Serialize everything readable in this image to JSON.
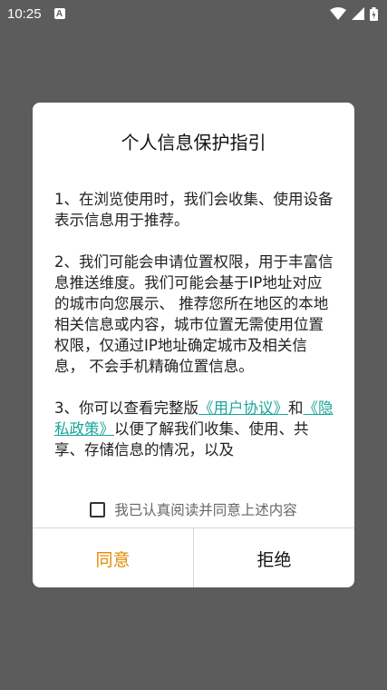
{
  "status_bar": {
    "time": "10:25",
    "notification_icon": "A",
    "icons": [
      "wifi-icon",
      "signal-icon",
      "battery-icon"
    ]
  },
  "dialog": {
    "title": "个人信息保护指引",
    "paragraph1": "1、在浏览使用时，我们会收集、使用设备表示信息用于推荐。",
    "paragraph2": " 2、我们可能会申请位置权限，用于丰富信息推送维度。我们可能会基于IP地址对应的城市向您展示、 推荐您所在地区的本地相关信息或内容，城市位置无需使用位置权限，仅通过IP地址确定城市及相关信息， 不会手机精确位置信息。",
    "paragraph3_prefix": " 3、你可以查看完整版",
    "user_agreement_link": "《用户协议》",
    "paragraph3_and": "和",
    "privacy_policy_link": "《隐私政策》",
    "paragraph3_suffix": "以便了解我们收集、使用、共享、存储信息的情况，以及",
    "agree_checkbox_label": "我已认真阅读并同意上述内容",
    "agree_button": "同意",
    "refuse_button": "拒绝"
  },
  "colors": {
    "scrim": "#5c5c5c",
    "link": "#1aa59a",
    "agree": "#e58a00"
  }
}
